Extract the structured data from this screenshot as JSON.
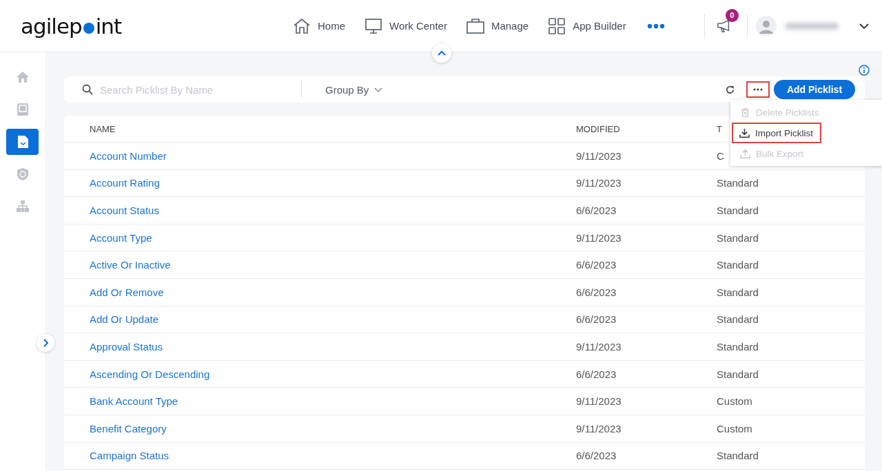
{
  "logo": {
    "before_dot": "agilep",
    "after_dot": "int"
  },
  "nav": [
    {
      "label": "Home"
    },
    {
      "label": "Work Center"
    },
    {
      "label": "Manage"
    },
    {
      "label": "App Builder"
    }
  ],
  "notifications": {
    "count": "0"
  },
  "sidebar": {
    "items": [
      {
        "selected": false
      },
      {
        "selected": false
      },
      {
        "selected": true
      },
      {
        "selected": false
      },
      {
        "selected": false
      }
    ]
  },
  "search": {
    "placeholder": "Search Picklist By Name"
  },
  "group_by": "Group By",
  "add_button": "Add Picklist",
  "menu": [
    {
      "label": "Delete Picklists",
      "disabled": true,
      "highlighted": false
    },
    {
      "label": "Import Picklist",
      "disabled": false,
      "highlighted": true
    },
    {
      "label": "Bulk Export",
      "disabled": true,
      "highlighted": false
    }
  ],
  "table": {
    "columns": [
      "NAME",
      "MODIFIED",
      "T"
    ],
    "rows": [
      [
        "Account Number",
        "9/11/2023",
        "C"
      ],
      [
        "Account Rating",
        "9/11/2023",
        "Standard"
      ],
      [
        "Account Status",
        "6/6/2023",
        "Standard"
      ],
      [
        "Account Type",
        "9/11/2023",
        "Standard"
      ],
      [
        "Active Or Inactive",
        "6/6/2023",
        "Standard"
      ],
      [
        "Add Or Remove",
        "6/6/2023",
        "Standard"
      ],
      [
        "Add Or Update",
        "6/6/2023",
        "Standard"
      ],
      [
        "Approval Status",
        "9/11/2023",
        "Standard"
      ],
      [
        "Ascending Or Descending",
        "6/6/2023",
        "Standard"
      ],
      [
        "Bank Account Type",
        "9/11/2023",
        "Custom"
      ],
      [
        "Benefit Category",
        "9/11/2023",
        "Custom"
      ],
      [
        "Campaign Status",
        "6/6/2023",
        "Standard"
      ]
    ]
  }
}
